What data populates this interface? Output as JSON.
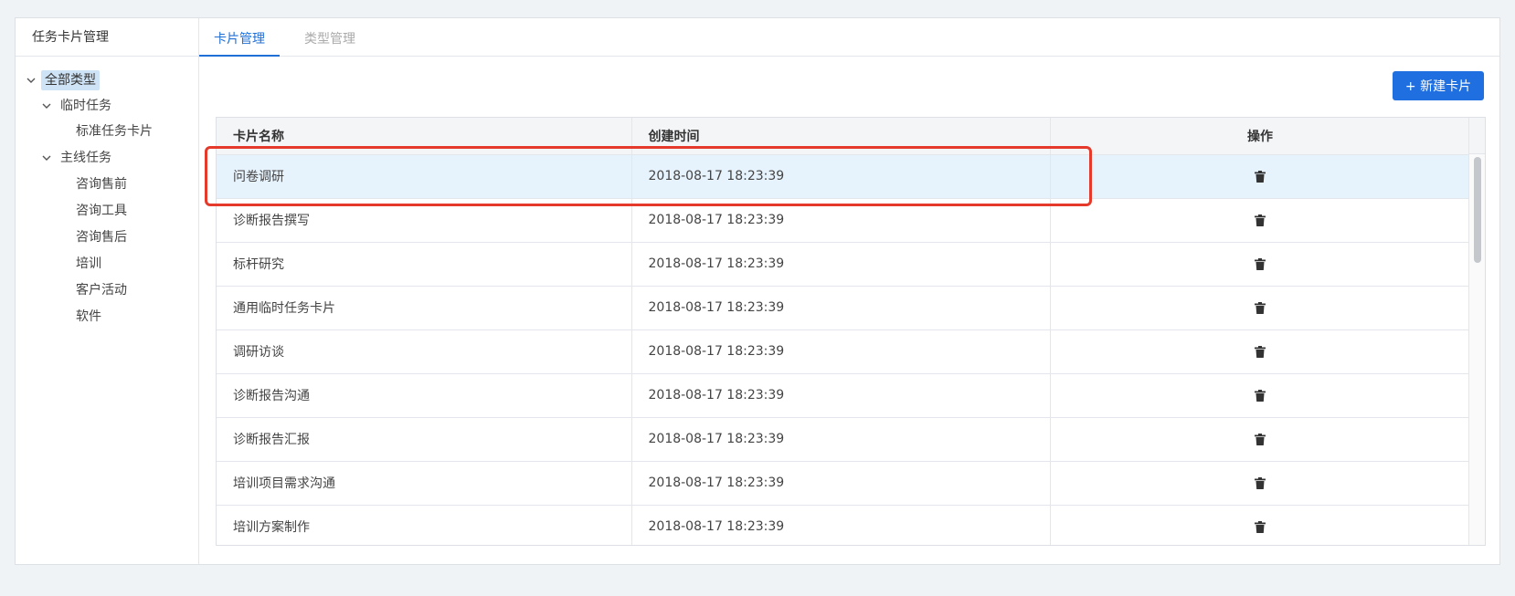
{
  "sidebar": {
    "title": "任务卡片管理",
    "tree": [
      {
        "label": "全部类型",
        "expanded": true,
        "selected": true
      },
      {
        "label": "临时任务",
        "expanded": true
      },
      {
        "label": "标准任务卡片"
      },
      {
        "label": "主线任务",
        "expanded": true
      },
      {
        "label": "咨询售前"
      },
      {
        "label": "咨询工具"
      },
      {
        "label": "咨询售后"
      },
      {
        "label": "培训"
      },
      {
        "label": "客户活动"
      },
      {
        "label": "软件"
      }
    ]
  },
  "tabs": [
    {
      "label": "卡片管理",
      "active": true
    },
    {
      "label": "类型管理",
      "active": false
    }
  ],
  "toolbar": {
    "new_card_label": "+ 新建卡片"
  },
  "table": {
    "columns": [
      "卡片名称",
      "创建时间",
      "操作"
    ],
    "rows": [
      {
        "name": "问卷调研",
        "created": "2018-08-17 18:23:39",
        "action_icon": "trash-icon"
      },
      {
        "name": "诊断报告撰写",
        "created": "2018-08-17 18:23:39",
        "action_icon": "trash-icon"
      },
      {
        "name": "标杆研究",
        "created": "2018-08-17 18:23:39",
        "action_icon": "trash-icon"
      },
      {
        "name": "通用临时任务卡片",
        "created": "2018-08-17 18:23:39",
        "action_icon": "trash-icon"
      },
      {
        "name": "调研访谈",
        "created": "2018-08-17 18:23:39",
        "action_icon": "trash-icon"
      },
      {
        "name": "诊断报告沟通",
        "created": "2018-08-17 18:23:39",
        "action_icon": "trash-icon"
      },
      {
        "name": "诊断报告汇报",
        "created": "2018-08-17 18:23:39",
        "action_icon": "trash-icon"
      },
      {
        "name": "培训项目需求沟通",
        "created": "2018-08-17 18:23:39",
        "action_icon": "trash-icon"
      },
      {
        "name": "培训方案制作",
        "created": "2018-08-17 18:23:39",
        "action_icon": "trash-icon"
      }
    ]
  },
  "colors": {
    "accent": "#1f6fe0",
    "row_highlight": "#e6f2fc",
    "annotation": "#e53a2b"
  }
}
